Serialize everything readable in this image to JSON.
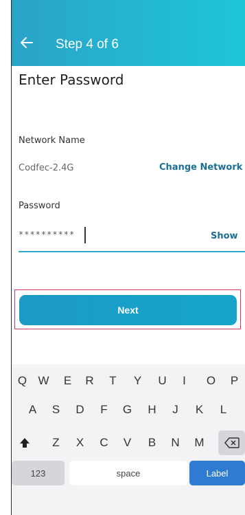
{
  "header": {
    "title": "Step 4 of 6",
    "back_icon": "arrow-left-icon"
  },
  "page": {
    "title": "Enter Password"
  },
  "network": {
    "label": "Network Name",
    "value": "Codfec-2.4G",
    "change_link": "Change Network"
  },
  "password": {
    "label": "Password",
    "masked_value": "**********",
    "show_link": "Show"
  },
  "next_button": {
    "label": "Next"
  },
  "keyboard": {
    "row1": [
      "Q",
      "W",
      "E",
      "R",
      "T",
      "Y",
      "U",
      "I",
      "O",
      "P"
    ],
    "row2": [
      "A",
      "S",
      "D",
      "F",
      "G",
      "H",
      "J",
      "K",
      "L"
    ],
    "row3": [
      "Z",
      "X",
      "C",
      "V",
      "B",
      "N",
      "M"
    ],
    "shift_icon": "shift-arrow-icon",
    "backspace_icon": "backspace-icon",
    "numbers_key": "123",
    "space_key": "space",
    "action_key": "Label"
  },
  "colors": {
    "header_start": "#2aa3c9",
    "header_end": "#1ec6d8",
    "button": "#1b9ac6",
    "link": "#1b6f95",
    "accent_line": "#2aa7cf"
  }
}
